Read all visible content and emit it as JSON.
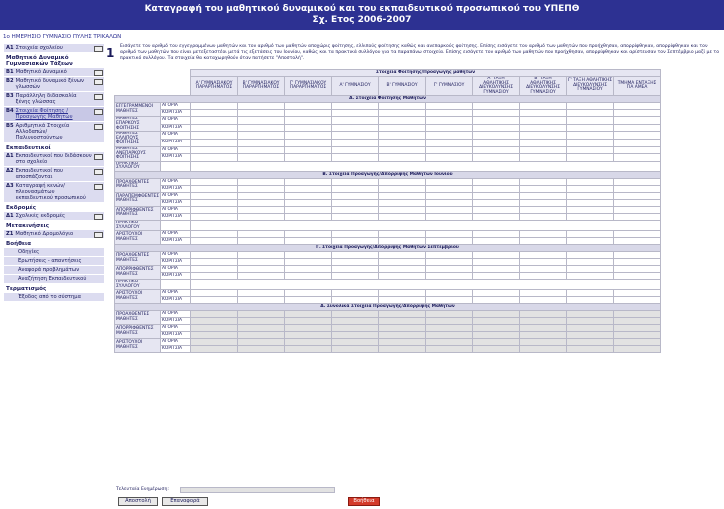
{
  "header": {
    "title": "Καταγραφή του μαθητικού δυναμικού και του εκπαιδευτικού προσωπικού του ΥΠΕΠΘ",
    "subtitle": "Σχ. Ετος 2006-2007"
  },
  "school": "1ο ΗΜΕΡΗΣΙΟ ΓΥΜΝΑΣΙΟ ΠΥΛΗΣ ΤΡΙΚΑΛΩΝ",
  "sidebar": {
    "items": [
      {
        "code": "Α1",
        "label": "Στοιχεία σχολείου",
        "icon": true
      },
      {
        "head": "Μαθητικό Δυναμικό Γυμνασιακών Τάξεων"
      },
      {
        "code": "Β1",
        "label": "Μαθητικό Δυναμικό",
        "icon": true
      },
      {
        "code": "Β2",
        "label": "Μαθητικό δυναμικό ξένων γλωσσών",
        "icon": true
      },
      {
        "code": "Β3",
        "label": "Παράλληλη διδασκαλία ξένης γλώσσας",
        "icon": true
      },
      {
        "code": "Β4",
        "label": "Στοιχεία Φοίτησης / Προαγωγής Μαθητών",
        "icon": true,
        "active": true
      },
      {
        "code": "Β5",
        "label": "Αριθμητικά Στοιχεία Αλλοδαπών/Παλιννοστούντων",
        "icon": true
      },
      {
        "head": "Εκπαιδευτικοί"
      },
      {
        "code": "Δ1",
        "label": "Εκπαιδευτικοί που διδάσκουν στο σχολείο",
        "icon": true
      },
      {
        "code": "Δ2",
        "label": "Εκπαιδευτικοί που αποσπάζονται",
        "icon": true
      },
      {
        "code": "Δ3",
        "label": "Καταγραφή κενών/πλεονασμάτων εκπαιδευτικού προσωπικού",
        "icon": true
      },
      {
        "head": "Εκδρομές"
      },
      {
        "code": "Δ1",
        "label": "Σχολικές εκδρομές",
        "icon": true
      },
      {
        "head": "Μετακινήσεις"
      },
      {
        "code": "Ζ1",
        "label": "Μαθητικό Δρομολόγιο",
        "icon": true
      },
      {
        "head": "Βοήθεια"
      },
      {
        "link": "Οδηγίες"
      },
      {
        "link": "Ερωτήσεις - απαντήσεις"
      },
      {
        "link": "Αναφορά προβλημάτων"
      },
      {
        "link": "Αναζήτηση Εκπαιδευτικού"
      },
      {
        "head": "Τερματισμός"
      },
      {
        "link": "Έξοδος από το σύστημα"
      }
    ]
  },
  "step_number": "1",
  "instructions": "Εισάγετε τον αριθμό του εγγεγραμμένων μαθητών και τον αριθμό των μαθητών αποχώρις φοίτησης, ελλιπούς φοίτησης καθώς και ανεπαρκούς φοίτησης. Επίσης εισάγετε τον αριθμό των μαθητών που προήχθησαν, απορρίφθηκαν, απορρίφθηκαν και τον αριθμό των μαθητών που είναι μετεξεταστέοι μετά τις εξετάσεις του Ιουνίου, καθώς και τα πρακτικά συλλόγου για τα παραπάνω στοιχεία. Επίσης εισάγετε τον αριθμό των μαθητών που προήχθησαν, απορρίφθηκαν και αρίστευσαν τον Σεπτέμβριο μαζί με το πρακτικό συλλόγου. Τα στοιχεία θα καταχωρηθούν όταν πατήσετε \"Αποστολή\".",
  "table": {
    "group_header": "Στοιχεία Φοίτησης/Προαγωγής μαθητών",
    "columns": [
      "Α' ΓΥΜΝΑΣΙΑΚΟΥ ΠΑΡΑΡΤΗΜΑΤΟΣ",
      "Β' ΓΥΜΝΑΣΙΑΚΟΥ ΠΑΡΑΡΤΗΜΑΤΟΣ",
      "Γ' ΓΥΜΝΑΣΙΑΚΟΥ ΠΑΡΑΡΤΗΜΑΤΟΣ",
      "Α' ΓΥΜΝΑΣΙΟΥ",
      "Β' ΓΥΜΝΑΣΙΟΥ",
      "Γ' ΓΥΜΝΑΣΙΟΥ",
      "Α' ΤΑΞΗ ΑΘΛΗΤΙΚΗΣ ΔΙΕΥΚΟΛΥΝΣΗΣ ΓΥΜΝΑΣΙΟΥ",
      "Β' ΤΑΞΗ ΑΘΛΗΤΙΚΗΣ ΔΙΕΥΚΟΛΥΝΣΗΣ ΓΥΜΝΑΣΙΟΥ",
      "Γ' ΤΑΞΗ ΑΘΛΗΤΙΚΗΣ ΔΙΕΥΚΟΛΥΝΣΗΣ ΓΥΜΝΑΣΙΟΥ",
      "ΤΜΗΜΑ ΕΝΤΑΞΗΣ ΓΙΑ ΑΜΕΑ"
    ],
    "boys": "ΑΓΟΡΙΑ",
    "girls": "ΚΟΡΙΤΣΙΑ",
    "sections": [
      {
        "title": "Α. Στοιχεία Φοίτησης Μαθητών",
        "gray": false,
        "rows": [
          "ΕΓΓΕΓΡΑΜΜΕΝΟΙ ΜΑΘΗΤΕΣ",
          "ΜΑΘΗΤΕΣ ΕΠΑΡΚΟΥΣ ΦΟΙΤΗΣΗΣ",
          "ΜΑΘΗΤΕΣ ΕΛΛΙΠΟΥΣ ΦΟΙΤΗΣΗΣ",
          "ΜΑΘΗΤΕΣ ΑΝΕΠΑΡΚΟΥΣ ΦΟΙΤΗΣΗΣ"
        ],
        "practical": "ΠΡΑΚΤΙΚΟ ΣΥΛΛΟΓΟΥ"
      },
      {
        "title": "Β. Στοιχεία Προαγωγής/Απόρριψης Μαθητών Ιουνίου",
        "gray": false,
        "rows": [
          "ΠΡΟΑΧΘΕΝΤΕΣ ΜΑΘΗΤΕΣ",
          "ΠΑΡΑΠΕΜΦΘΕΝΤΕΣ ΜΑΘΗΤΕΣ",
          "ΑΠΟΡΡΙΦΘΕΝΤΕΣ ΜΑΘΗΤΕΣ"
        ],
        "practical": "ΠΡΑΚΤΙΚΟ ΣΥΛΛΟΓΟΥ",
        "extra": [
          "ΑΡΙΣΤΟΥΧΟΙ ΜΑΘΗΤΕΣ"
        ]
      },
      {
        "title": "Γ. Στοιχεία Προαγωγής/Απόρριψης Μαθητών Σεπτεμβρίου",
        "gray": false,
        "rows": [
          "ΠΡΟΑΧΘΕΝΤΕΣ ΜΑΘΗΤΕΣ",
          "ΑΠΟΡΡΙΦΘΕΝΤΕΣ ΜΑΘΗΤΕΣ"
        ],
        "practical": "ΠΡΑΚΤΙΚΟ ΣΥΛΛΟΓΟΥ",
        "extra": [
          "ΑΡΙΣΤΟΥΧΟΙ ΜΑΘΗΤΕΣ"
        ]
      },
      {
        "title": "Δ. Συνολικά Στοιχεία Προαγωγής/Απόρριψης Μαθητών",
        "gray": true,
        "rows": [
          "ΠΡΟΑΧΘΕΝΤΕΣ ΜΑΘΗΤΕΣ",
          "ΑΠΟΡΡΙΦΘΕΝΤΕΣ ΜΑΘΗΤΕΣ",
          "ΑΡΙΣΤΟΥΧΟΙ ΜΑΘΗΤΕΣ"
        ]
      }
    ]
  },
  "last_update_label": "Τελευταία Ενημέρωση:",
  "buttons": {
    "submit": "Αποστολή",
    "back": "Επαναφορά",
    "help": "Βοήθεια"
  }
}
